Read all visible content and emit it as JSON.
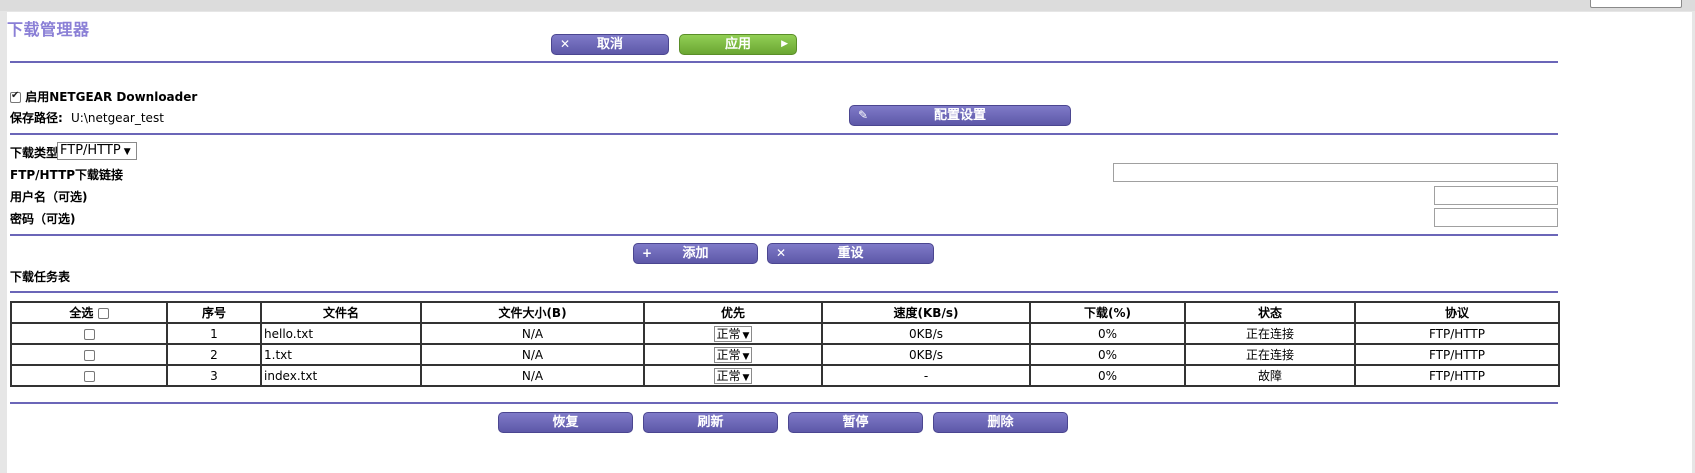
{
  "page": {
    "title": "下载管理器"
  },
  "toolbar": {
    "cancel_label": "取消",
    "apply_label": "应用"
  },
  "settings": {
    "enable_label": "启用NETGEAR Downloader",
    "enable_checked": true,
    "save_path_label": "保存路径:",
    "save_path_value": "U:\\netgear_test",
    "config_button": "配置设置"
  },
  "download_form": {
    "type_label": "下载类型",
    "type_value": "FTP/HTTP",
    "link_label": "FTP/HTTP下载链接",
    "username_label": "用户名（可选)",
    "password_label": "密码（可选)",
    "link_value": "",
    "username_value": "",
    "password_value": "",
    "add_button": "添加",
    "reset_button": "重设"
  },
  "task_table": {
    "title": "下载任务表",
    "columns": [
      "全选",
      "序号",
      "文件名",
      "文件大小(B)",
      "优先",
      "速度(KB/s)",
      "下载(%)",
      "状态",
      "协议"
    ],
    "rows": [
      {
        "index": "1",
        "filename": "hello.txt",
        "size": "N/A",
        "priority": "正常",
        "speed": "0KB/s",
        "progress": "0%",
        "status": "正在连接",
        "protocol": "FTP/HTTP"
      },
      {
        "index": "2",
        "filename": "1.txt",
        "size": "N/A",
        "priority": "正常",
        "speed": "0KB/s",
        "progress": "0%",
        "status": "正在连接",
        "protocol": "FTP/HTTP"
      },
      {
        "index": "3",
        "filename": "index.txt",
        "size": "N/A",
        "priority": "正常",
        "speed": "-",
        "progress": "0%",
        "status": "故障",
        "protocol": "FTP/HTTP"
      }
    ]
  },
  "bottom_actions": {
    "resume": "恢复",
    "refresh": "刷新",
    "pause": "暂停",
    "delete": "删除"
  },
  "colors": {
    "accent": "#6b66b8",
    "title": "#8a7fd6",
    "apply": "#7dbb42"
  },
  "icons": {
    "cancel": "close-icon",
    "apply": "play-arrow-icon",
    "config": "pencil-icon",
    "add": "plus-icon",
    "reset": "close-icon"
  }
}
